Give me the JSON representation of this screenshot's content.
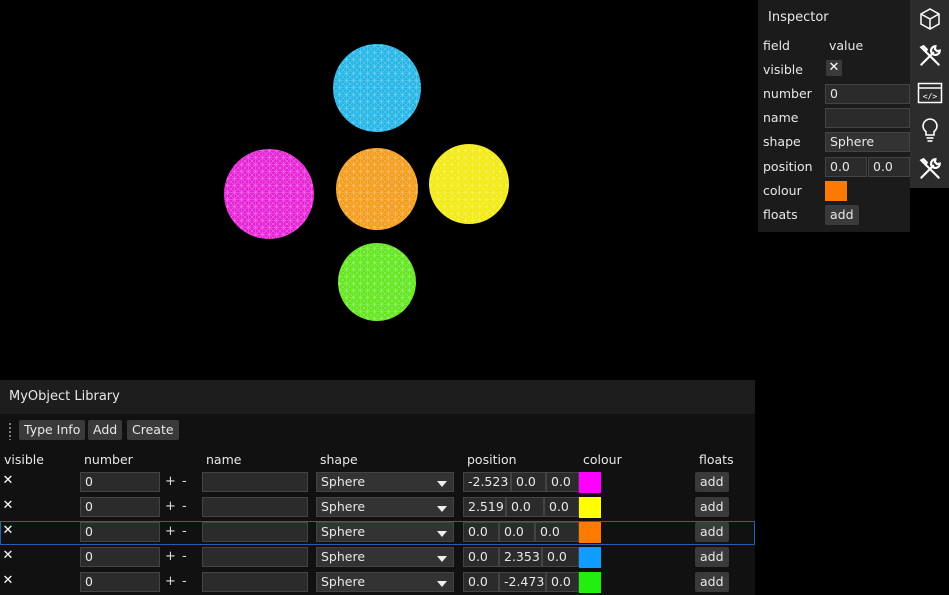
{
  "viewport": {
    "spheres": [
      {
        "color": "#1fb4e6"
      },
      {
        "color": "#e61fd6"
      },
      {
        "color": "#f49a16"
      },
      {
        "color": "#f2ea0c"
      },
      {
        "color": "#5fe61a"
      }
    ]
  },
  "inspector": {
    "title": "Inspector",
    "headers": {
      "field": "field",
      "value": "value"
    },
    "fields": {
      "visible": {
        "label": "visible",
        "checked": true,
        "mark": "✕"
      },
      "number": {
        "label": "number",
        "value": "0"
      },
      "name": {
        "label": "name",
        "value": ""
      },
      "shape": {
        "label": "shape",
        "value": "Sphere"
      },
      "position": {
        "label": "position",
        "x": "0.0",
        "y": "0.0"
      },
      "colour": {
        "label": "colour",
        "value": "#ff7a00"
      },
      "floats": {
        "label": "floats",
        "button": "add"
      }
    }
  },
  "toolbar": {
    "icons": [
      "cube-icon",
      "wrench-screwdriver-icon",
      "code-window-icon",
      "lightbulb-icon",
      "wrench-screwdriver-icon"
    ]
  },
  "library": {
    "title": "MyObject Library",
    "buttons": {
      "type_info": "Type Info",
      "add": "Add",
      "create": "Create"
    },
    "columns": {
      "visible": "visible",
      "number": "number",
      "name": "name",
      "shape": "shape",
      "position": "position",
      "colour": "colour",
      "floats": "floats"
    },
    "plus": "+",
    "minus": "-",
    "rows": [
      {
        "visible": "✕",
        "number": "0",
        "name": "",
        "shape": "Sphere",
        "pos": [
          "-2.523",
          "0.0",
          "0.0"
        ],
        "colour": "#ff00ff",
        "floats": "add"
      },
      {
        "visible": "✕",
        "number": "0",
        "name": "",
        "shape": "Sphere",
        "pos": [
          "2.519",
          "0.0",
          "0.0"
        ],
        "colour": "#ffff00",
        "floats": "add"
      },
      {
        "visible": "✕",
        "number": "0",
        "name": "",
        "shape": "Sphere",
        "pos": [
          "0.0",
          "0.0",
          "0.0"
        ],
        "colour": "#ff7a00",
        "floats": "add",
        "selected": true
      },
      {
        "visible": "✕",
        "number": "0",
        "name": "",
        "shape": "Sphere",
        "pos": [
          "0.0",
          "2.353",
          "0.0"
        ],
        "colour": "#0f9dff",
        "floats": "add"
      },
      {
        "visible": "✕",
        "number": "0",
        "name": "",
        "shape": "Sphere",
        "pos": [
          "0.0",
          "-2.473",
          "0.0"
        ],
        "colour": "#22ee10",
        "floats": "add"
      }
    ]
  }
}
